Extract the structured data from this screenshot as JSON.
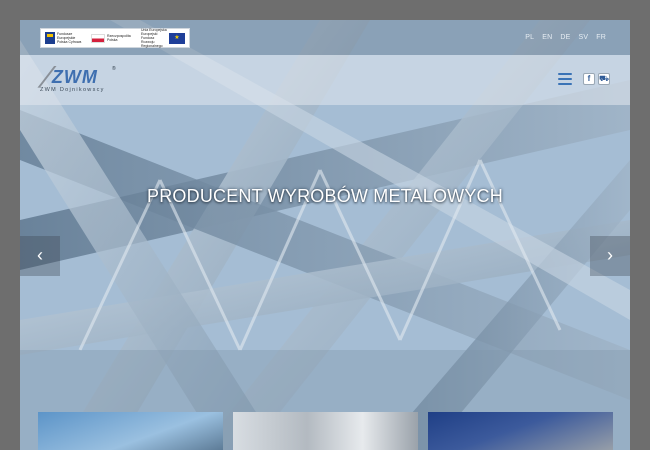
{
  "topbar": {
    "eu_banner": {
      "fe_text": "Fundusze Europejskie Polska Cyfrowa",
      "pl_text": "Rzeczpospolita Polska",
      "ue_text": "Unia Europejska Europejski Fundusz Rozwoju Regionalnego"
    },
    "languages": [
      "PL",
      "EN",
      "DE",
      "SV",
      "FR"
    ]
  },
  "header": {
    "logo_mark_a": "╱",
    "logo_mark": "ZWM",
    "logo_registered": "®",
    "logo_subtitle": "ZWM Dojnikowscy",
    "icons": {
      "menu": "hamburger-menu-icon",
      "facebook": "facebook-icon",
      "cart": "cart-icon"
    },
    "facebook_glyph": "f",
    "cart_glyph": "☰"
  },
  "hero": {
    "headline": "PRODUCENT WYROBÓW METALOWYCH",
    "prev_glyph": "‹",
    "next_glyph": "›"
  },
  "colors": {
    "background": "#6e6e6e",
    "accent_blue": "#3a73b6",
    "headline": "#ffffff"
  }
}
